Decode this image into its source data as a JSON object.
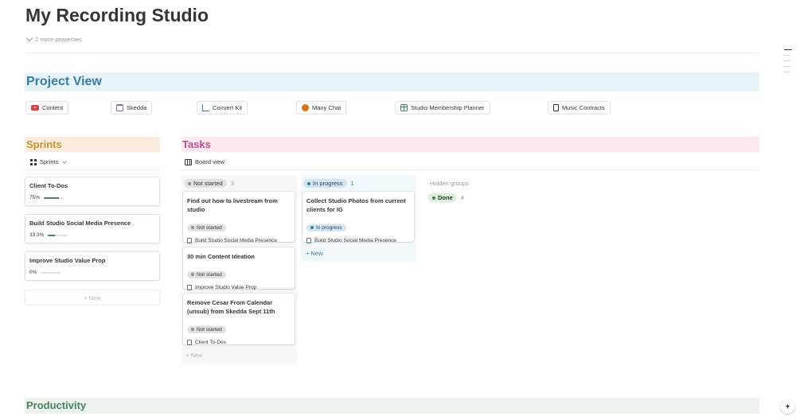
{
  "page": {
    "title": "My Recording Studio",
    "more_properties": "2 more properties"
  },
  "project_view": {
    "title": "Project View",
    "links": [
      {
        "label": "Content",
        "icon": "youtube-icon"
      },
      {
        "label": "Skedda",
        "icon": "calendar-icon"
      },
      {
        "label": "Convert Kit",
        "icon": "chart-icon"
      },
      {
        "label": "Many Chat",
        "icon": "chat-bubble-icon"
      },
      {
        "label": "Studio Membership Planner",
        "icon": "table-icon"
      },
      {
        "label": "Music Contracts",
        "icon": "document-icon"
      }
    ]
  },
  "sprints": {
    "title": "Sprints",
    "view_label": "Sprints",
    "items": [
      {
        "name": "Client To-Dos",
        "progress_label": "75%",
        "progress": 0.75
      },
      {
        "name": "Build Studio Social Media Presence",
        "progress_label": "33.3%",
        "progress": 0.333
      },
      {
        "name": "Improve Studio Value Prop",
        "progress_label": "0%",
        "progress": 0
      }
    ],
    "new_label": "+ New"
  },
  "tasks": {
    "title": "Tasks",
    "view_label": "Board view",
    "columns": [
      {
        "status": "Not started",
        "count": "3",
        "cards": [
          {
            "title": "Find out how to livestream from studio",
            "status": "Not started",
            "relation": "Build Studio Social Media Presence"
          },
          {
            "title": "30 min Content Ideation",
            "status": "Not started",
            "relation": "Improve Studio Value Prop"
          },
          {
            "title": "Remove Cesar From Calendar (unsub) from Skedda Sept 11th",
            "status": "Not started",
            "relation": "Client To-Dos"
          }
        ],
        "new_label": "+ New"
      },
      {
        "status": "In progress",
        "count": "1",
        "cards": [
          {
            "title": "Collect Studio Photos from current clients for IG",
            "status": "In progress",
            "relation": "Build Studio Social Media Presence"
          }
        ],
        "new_label": "+ New"
      }
    ],
    "hidden_groups_label": "Hidden groups",
    "hidden_groups": [
      {
        "status": "Done",
        "count": "4"
      }
    ]
  },
  "productivity": {
    "title": "Productivity"
  },
  "assistant_button": {
    "icon": "sparkle-icon"
  },
  "colors": {
    "project_view_bg": "#e7f3f8",
    "project_view_text": "#337ea9",
    "sprints_bg": "#fbecdd",
    "sprints_text": "#cb912f",
    "tasks_bg": "#fbe9ee",
    "tasks_text": "#c14c8a",
    "productivity_bg": "#edf3ec",
    "productivity_text": "#448361",
    "progress_fill": "#448361"
  }
}
